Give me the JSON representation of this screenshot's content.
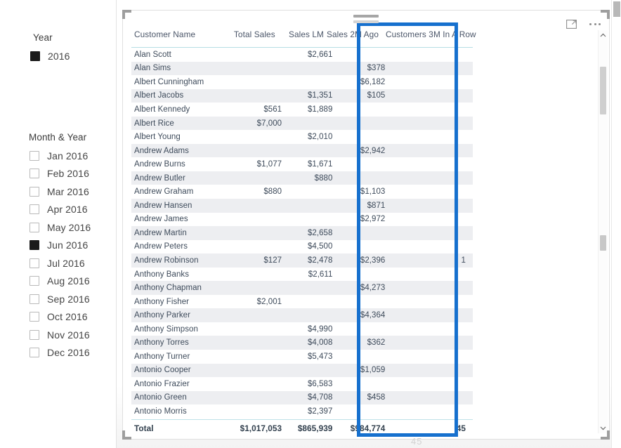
{
  "filter_pane": {
    "year_slicer": {
      "title": "Year",
      "items": [
        {
          "label": "2016",
          "checked": true
        }
      ]
    },
    "month_slicer": {
      "title": "Month & Year",
      "items": [
        {
          "label": "Jan 2016",
          "checked": false
        },
        {
          "label": "Feb 2016",
          "checked": false
        },
        {
          "label": "Mar 2016",
          "checked": false
        },
        {
          "label": "Apr 2016",
          "checked": false
        },
        {
          "label": "May 2016",
          "checked": false
        },
        {
          "label": "Jun 2016",
          "checked": true
        },
        {
          "label": "Jul 2016",
          "checked": false
        },
        {
          "label": "Aug 2016",
          "checked": false
        },
        {
          "label": "Sep 2016",
          "checked": false
        },
        {
          "label": "Oct 2016",
          "checked": false
        },
        {
          "label": "Nov 2016",
          "checked": false
        },
        {
          "label": "Dec 2016",
          "checked": false
        }
      ]
    }
  },
  "visual": {
    "icons": {
      "focus_mode": "focus-mode-icon",
      "more_options": "more-options-icon",
      "drag_handle": "drag-handle-icon"
    },
    "highlight_color": "#1670ce",
    "highlighted_column": "Customers 3M In A Row",
    "ghost_label": "45"
  },
  "table": {
    "columns": [
      "Customer Name",
      "Total Sales",
      "Sales LM",
      "Sales 2M Ago",
      "Customers 3M In A Row"
    ],
    "rows": [
      {
        "name": "Alan Scott",
        "total": "",
        "lm": "$2,661",
        "m2": "",
        "c3m": ""
      },
      {
        "name": "Alan Sims",
        "total": "",
        "lm": "",
        "m2": "$378",
        "c3m": ""
      },
      {
        "name": "Albert Cunningham",
        "total": "",
        "lm": "",
        "m2": "$6,182",
        "c3m": ""
      },
      {
        "name": "Albert Jacobs",
        "total": "",
        "lm": "$1,351",
        "m2": "$105",
        "c3m": ""
      },
      {
        "name": "Albert Kennedy",
        "total": "$561",
        "lm": "$1,889",
        "m2": "",
        "c3m": ""
      },
      {
        "name": "Albert Rice",
        "total": "$7,000",
        "lm": "",
        "m2": "",
        "c3m": ""
      },
      {
        "name": "Albert Young",
        "total": "",
        "lm": "$2,010",
        "m2": "",
        "c3m": ""
      },
      {
        "name": "Andrew Adams",
        "total": "",
        "lm": "",
        "m2": "$2,942",
        "c3m": ""
      },
      {
        "name": "Andrew Burns",
        "total": "$1,077",
        "lm": "$1,671",
        "m2": "",
        "c3m": ""
      },
      {
        "name": "Andrew Butler",
        "total": "",
        "lm": "$880",
        "m2": "",
        "c3m": ""
      },
      {
        "name": "Andrew Graham",
        "total": "$880",
        "lm": "",
        "m2": "$1,103",
        "c3m": ""
      },
      {
        "name": "Andrew Hansen",
        "total": "",
        "lm": "",
        "m2": "$871",
        "c3m": ""
      },
      {
        "name": "Andrew James",
        "total": "",
        "lm": "",
        "m2": "$2,972",
        "c3m": ""
      },
      {
        "name": "Andrew Martin",
        "total": "",
        "lm": "$2,658",
        "m2": "",
        "c3m": ""
      },
      {
        "name": "Andrew Peters",
        "total": "",
        "lm": "$4,500",
        "m2": "",
        "c3m": ""
      },
      {
        "name": "Andrew Robinson",
        "total": "$127",
        "lm": "$2,478",
        "m2": "$2,396",
        "c3m": "1"
      },
      {
        "name": "Anthony Banks",
        "total": "",
        "lm": "$2,611",
        "m2": "",
        "c3m": ""
      },
      {
        "name": "Anthony Chapman",
        "total": "",
        "lm": "",
        "m2": "$4,273",
        "c3m": ""
      },
      {
        "name": "Anthony Fisher",
        "total": "$2,001",
        "lm": "",
        "m2": "",
        "c3m": ""
      },
      {
        "name": "Anthony Parker",
        "total": "",
        "lm": "",
        "m2": "$4,364",
        "c3m": ""
      },
      {
        "name": "Anthony Simpson",
        "total": "",
        "lm": "$4,990",
        "m2": "",
        "c3m": ""
      },
      {
        "name": "Anthony Torres",
        "total": "",
        "lm": "$4,008",
        "m2": "$362",
        "c3m": ""
      },
      {
        "name": "Anthony Turner",
        "total": "",
        "lm": "$5,473",
        "m2": "",
        "c3m": ""
      },
      {
        "name": "Antonio Cooper",
        "total": "",
        "lm": "",
        "m2": "$1,059",
        "c3m": ""
      },
      {
        "name": "Antonio Frazier",
        "total": "",
        "lm": "$6,583",
        "m2": "",
        "c3m": ""
      },
      {
        "name": "Antonio Green",
        "total": "",
        "lm": "$4,708",
        "m2": "$458",
        "c3m": ""
      },
      {
        "name": "Antonio Morris",
        "total": "",
        "lm": "$2,397",
        "m2": "",
        "c3m": ""
      }
    ],
    "total_row": {
      "name": "Total",
      "total": "$1,017,053",
      "lm": "$865,939",
      "m2": "$984,774",
      "c3m": "45"
    }
  }
}
